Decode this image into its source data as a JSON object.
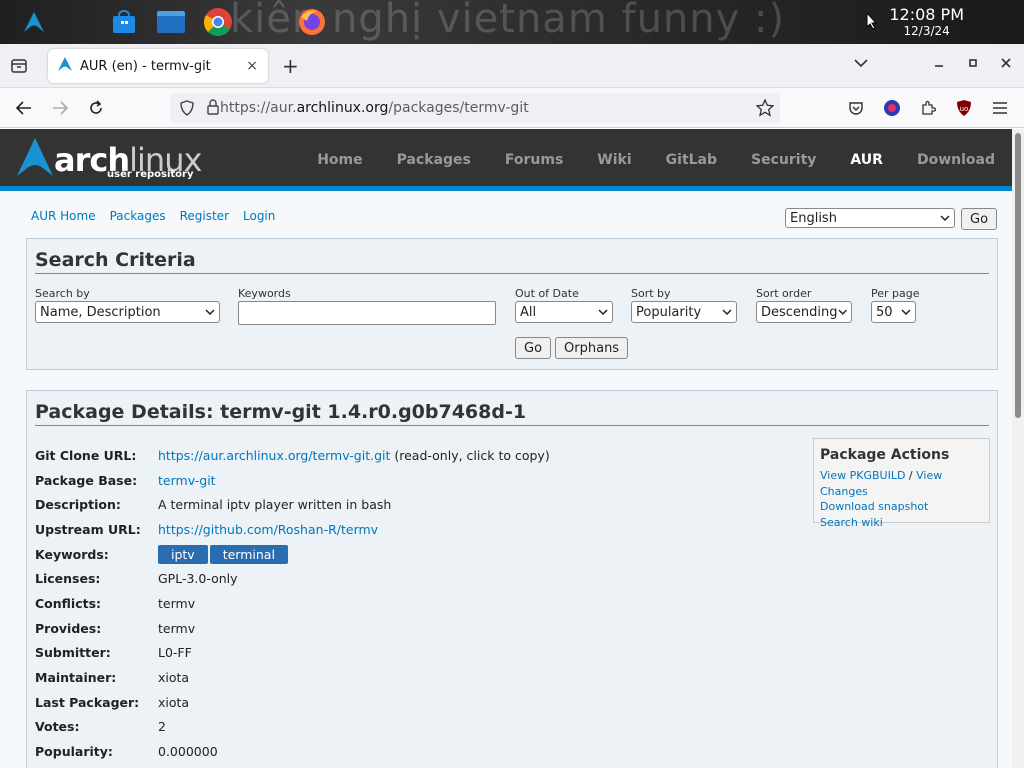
{
  "taskbar": {
    "wallpaper_text": "kiên nghị vietnam funny :)",
    "clock_time": "12:08 PM",
    "clock_date": "12/3/24",
    "icons": [
      "arch-logo-icon",
      "store-icon",
      "files-icon",
      "chrome-icon",
      "firefox-icon"
    ]
  },
  "browser": {
    "tab_title": "AUR (en) - termv-git",
    "url_host_pre": "https://aur.",
    "url_host": "archlinux.org",
    "url_path": "/packages/termv-git",
    "new_tab": "+",
    "tab_close": "×"
  },
  "arch_header": {
    "logo_arch": "arch",
    "logo_linux": "linux",
    "logo_sub": "user repository",
    "menu": [
      "Home",
      "Packages",
      "Forums",
      "Wiki",
      "GitLab",
      "Security",
      "AUR",
      "Download"
    ],
    "active": "AUR"
  },
  "subnav": [
    "AUR Home",
    "Packages",
    "Register",
    "Login"
  ],
  "language": {
    "selected": "English",
    "go": "Go"
  },
  "search": {
    "title": "Search Criteria",
    "search_by_label": "Search by",
    "search_by_value": "Name, Description",
    "keywords_label": "Keywords",
    "keywords_value": "",
    "out_of_date_label": "Out of Date",
    "out_of_date_value": "All",
    "sort_by_label": "Sort by",
    "sort_by_value": "Popularity",
    "sort_order_label": "Sort order",
    "sort_order_value": "Descending",
    "per_page_label": "Per page",
    "per_page_value": "50",
    "go": "Go",
    "orphans": "Orphans"
  },
  "details": {
    "title": "Package Details: termv-git 1.4.r0.g0b7468d-1",
    "rows": [
      {
        "label": "Git Clone URL:",
        "link": "https://aur.archlinux.org/termv-git.git",
        "extra": " (read-only, click to copy)"
      },
      {
        "label": "Package Base:",
        "link": "termv-git",
        "extra": ""
      },
      {
        "label": "Description:",
        "text": "A terminal iptv player written in bash"
      },
      {
        "label": "Upstream URL:",
        "link": "https://github.com/Roshan-R/termv",
        "extra": ""
      },
      {
        "label": "Keywords:",
        "keywords": [
          "iptv",
          "terminal"
        ]
      },
      {
        "label": "Licenses:",
        "text": "GPL-3.0-only"
      },
      {
        "label": "Conflicts:",
        "text": "termv"
      },
      {
        "label": "Provides:",
        "text": "termv"
      },
      {
        "label": "Submitter:",
        "text": "L0-FF"
      },
      {
        "label": "Maintainer:",
        "text": "xiota"
      },
      {
        "label": "Last Packager:",
        "text": "xiota"
      },
      {
        "label": "Votes:",
        "text": "2"
      },
      {
        "label": "Popularity:",
        "text": "0.000000"
      }
    ]
  },
  "package_actions": {
    "title": "Package Actions",
    "view_pkgbuild": "View PKGBUILD",
    "separator": " / ",
    "view_changes": "View Changes",
    "download_snapshot": "Download snapshot",
    "search_wiki": "Search wiki"
  },
  "colors": {
    "arch_blue": "#0088cc",
    "link": "#0077bb",
    "keyword_bg": "#2a6cb0",
    "header_bg": "#333333"
  }
}
